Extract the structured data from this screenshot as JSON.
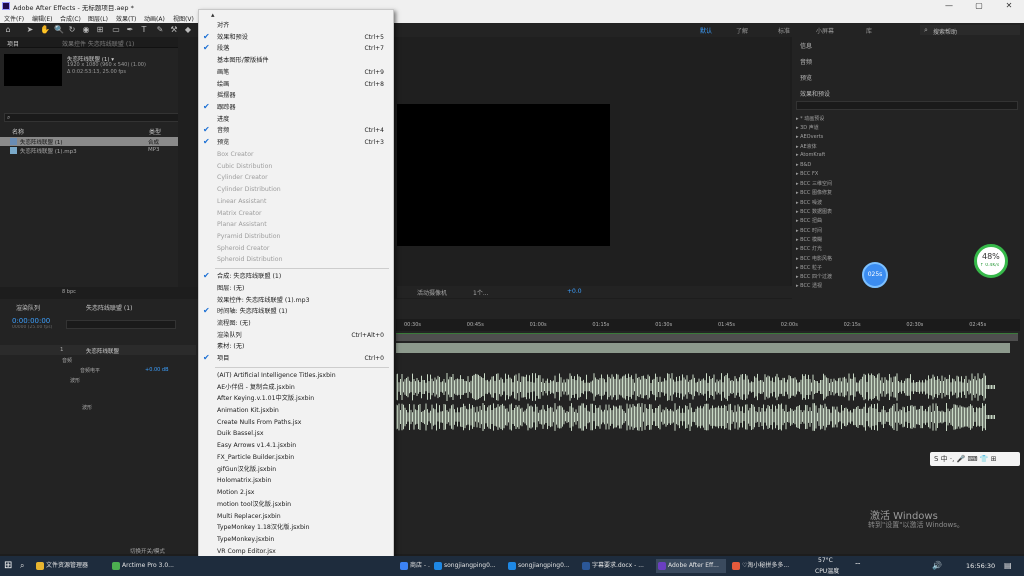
{
  "window": {
    "title": "Adobe After Effects - 无标题项目.aep *",
    "minimize": "—",
    "maximize": "▢",
    "close": "✕"
  },
  "menubar": [
    "文件(F)",
    "编辑(E)",
    "合成(C)",
    "图层(L)",
    "效果(T)",
    "动画(A)",
    "视图(V)"
  ],
  "toolbar": {
    "workspaces": [
      "默认",
      "了解",
      "标准",
      "小屏幕",
      "库"
    ],
    "active_workspace": "默认",
    "search_help": "搜索帮助"
  },
  "project_panel": {
    "tab_project": "项目",
    "tab_effects": "效果控件 失恋阵线联盟 (1)",
    "comp_name": "失恋阵线联盟 (1) ▾",
    "comp_info_1": "1920 x 1080 (960 x 540) (1.00)",
    "comp_info_2": "Δ 0:02:53:13, 25.00 fps",
    "col_name": "名称",
    "col_type": "类型",
    "items": [
      {
        "name": "失恋阵线联盟 (1)",
        "type": "合成"
      },
      {
        "name": "失恋阵线联盟 (1).mp3",
        "type": "MP3"
      }
    ],
    "bpc": "8 bpc"
  },
  "viewer": {
    "camera": "活动摄像机",
    "views": "1个...",
    "exposure": "+0.0"
  },
  "right_panels": {
    "info": "信息",
    "audio": "音频",
    "preview": "预览",
    "effects_presets": "效果和预设",
    "fx_items": [
      "▸ * 动画预设",
      "▸ 3D 声道",
      "▸ AEOverts",
      "▸ AE液体",
      "▸ AtomKraft",
      "▸ B&D",
      "▸ BCC FX",
      "▸ BCC 三维空间",
      "▸ BCC 图像修复",
      "▸ BCC 噪波",
      "▸ BCC 数据图表",
      "▸ BCC 扭曲",
      "▸ BCC 时间",
      "▸ BCC 模糊",
      "▸ BCC 灯光",
      "▸ BCC 电影风格",
      "▸ BCC 粒子",
      "▸ BCC 四个过渡",
      "▸ BCC 透视"
    ]
  },
  "timeline": {
    "render_queue": "渲染队列",
    "comp_tab": "失恋阵线联盟 (1)",
    "timecode": "0:00:00:00",
    "frame_info": "00000 (25.00 fps)",
    "layer_name": "失恋阵线联盟",
    "layer_num": "1",
    "prop_audio": "音频",
    "prop_level": "音频电平",
    "prop_level_val": "+0.00 dB",
    "prop_waveform": "波形",
    "prop_waveform2": "波形",
    "ruler": [
      "00:30s",
      "00:45s",
      "01:00s",
      "01:15s",
      "01:30s",
      "01:45s",
      "02:00s",
      "02:15s",
      "02:30s",
      "02:45s"
    ],
    "switch_mode": "切换开关/模式"
  },
  "window_menu": {
    "items": [
      {
        "label": "对齐",
        "checked": false,
        "shortcut": "",
        "disabled": false
      },
      {
        "label": "效果和预设",
        "checked": true,
        "shortcut": "Ctrl+5",
        "disabled": false
      },
      {
        "label": "段落",
        "checked": true,
        "shortcut": "Ctrl+7",
        "disabled": false
      },
      {
        "label": "基本图形/蒙版插件",
        "checked": false,
        "shortcut": "",
        "disabled": false
      },
      {
        "label": "画笔",
        "checked": false,
        "shortcut": "Ctrl+9",
        "disabled": false
      },
      {
        "label": "绘画",
        "checked": false,
        "shortcut": "Ctrl+8",
        "disabled": false
      },
      {
        "label": "摇摆器",
        "checked": false,
        "shortcut": "",
        "disabled": false
      },
      {
        "label": "跟踪器",
        "checked": true,
        "shortcut": "",
        "disabled": false
      },
      {
        "label": "进度",
        "checked": false,
        "shortcut": "",
        "disabled": false
      },
      {
        "label": "音频",
        "checked": true,
        "shortcut": "Ctrl+4",
        "disabled": false
      },
      {
        "label": "预览",
        "checked": true,
        "shortcut": "Ctrl+3",
        "disabled": false
      },
      {
        "label": "Box Creator",
        "checked": false,
        "shortcut": "",
        "disabled": true
      },
      {
        "label": "Cubic Distribution",
        "checked": false,
        "shortcut": "",
        "disabled": true
      },
      {
        "label": "Cylinder Creator",
        "checked": false,
        "shortcut": "",
        "disabled": true
      },
      {
        "label": "Cylinder Distribution",
        "checked": false,
        "shortcut": "",
        "disabled": true
      },
      {
        "label": "Linear Assistant",
        "checked": false,
        "shortcut": "",
        "disabled": true
      },
      {
        "label": "Matrix Creator",
        "checked": false,
        "shortcut": "",
        "disabled": true
      },
      {
        "label": "Planar Assistant",
        "checked": false,
        "shortcut": "",
        "disabled": true
      },
      {
        "label": "Pyramid Distribution",
        "checked": false,
        "shortcut": "",
        "disabled": true
      },
      {
        "label": "Spheroid Creator",
        "checked": false,
        "shortcut": "",
        "disabled": true
      },
      {
        "label": "Spheroid Distribution",
        "checked": false,
        "shortcut": "",
        "disabled": true
      },
      {
        "sep": true
      },
      {
        "label": "合成: 失恋阵线联盟 (1)",
        "checked": true,
        "shortcut": "",
        "disabled": false
      },
      {
        "label": "图层: (无)",
        "checked": false,
        "shortcut": "",
        "disabled": false
      },
      {
        "label": "效果控件: 失恋阵线联盟 (1).mp3",
        "checked": false,
        "shortcut": "",
        "disabled": false
      },
      {
        "label": "时间轴: 失恋阵线联盟 (1)",
        "checked": true,
        "shortcut": "",
        "disabled": false
      },
      {
        "label": "流程图: (无)",
        "checked": false,
        "shortcut": "",
        "disabled": false
      },
      {
        "label": "渲染队列",
        "checked": false,
        "shortcut": "Ctrl+Alt+0",
        "disabled": false
      },
      {
        "label": "素材: (无)",
        "checked": false,
        "shortcut": "",
        "disabled": false
      },
      {
        "label": "项目",
        "checked": true,
        "shortcut": "Ctrl+0",
        "disabled": false
      },
      {
        "sep": true
      },
      {
        "label": "(AIT) Artificial Intelligence Titles.jsxbin",
        "checked": false,
        "shortcut": "",
        "disabled": false
      },
      {
        "label": "AE小伴侣 - 复制合成.jsxbin",
        "checked": false,
        "shortcut": "",
        "disabled": false
      },
      {
        "label": "After Keying.v.1.01中文版.jsxbin",
        "checked": false,
        "shortcut": "",
        "disabled": false
      },
      {
        "label": "Animation Kit.jsxbin",
        "checked": false,
        "shortcut": "",
        "disabled": false
      },
      {
        "label": "Create Nulls From Paths.jsx",
        "checked": false,
        "shortcut": "",
        "disabled": false
      },
      {
        "label": "Duik Bassel.jsx",
        "checked": false,
        "shortcut": "",
        "disabled": false
      },
      {
        "label": "Easy Arrows v1.4.1.jsxbin",
        "checked": false,
        "shortcut": "",
        "disabled": false
      },
      {
        "label": "FX_Particle Builder.jsxbin",
        "checked": false,
        "shortcut": "",
        "disabled": false
      },
      {
        "label": "gifGun汉化版.jsxbin",
        "checked": false,
        "shortcut": "",
        "disabled": false
      },
      {
        "label": "Holomatrix.jsxbin",
        "checked": false,
        "shortcut": "",
        "disabled": false
      },
      {
        "label": "Motion 2.jsx",
        "checked": false,
        "shortcut": "",
        "disabled": false
      },
      {
        "label": "motion tool汉化版.jsxbin",
        "checked": false,
        "shortcut": "",
        "disabled": false
      },
      {
        "label": "Multi Replacer.jsxbin",
        "checked": false,
        "shortcut": "",
        "disabled": false
      },
      {
        "label": "TypeMonkey 1.18汉化版.jsxbin",
        "checked": false,
        "shortcut": "",
        "disabled": false
      },
      {
        "label": "TypeMonkey.jsxbin",
        "checked": false,
        "shortcut": "",
        "disabled": false
      },
      {
        "label": "VR Comp Editor.jsx",
        "checked": false,
        "shortcut": "",
        "disabled": false
      }
    ]
  },
  "taskbar": {
    "tasks": [
      {
        "label": "文件资源管理器",
        "color": "#e8b530"
      },
      {
        "label": "Arctime Pro 3.0...",
        "color": "#4caf50"
      },
      {
        "label": "商店 - ...",
        "color": "#3b82f6"
      },
      {
        "label": "songjiangping0...",
        "color": "#1e88e5"
      },
      {
        "label": "songjiangping0...",
        "color": "#1e88e5"
      },
      {
        "label": "字幕要求.docx - ...",
        "color": "#2b5797"
      },
      {
        "label": "Adobe After Eff...",
        "color": "#6a3fc1",
        "active": true
      },
      {
        "label": "♡淘小秘拼多多...",
        "color": "#e55a3c"
      }
    ],
    "temperature": "57°C",
    "cpu_label": "CPU温度",
    "time": "16:56:30"
  },
  "overlays": {
    "activate_windows": "激活 Windows",
    "activate_hint": "转到\"设置\"以激活 Windows。",
    "perf_percent": "48%",
    "perf_speed": "↑ 0.4K/s",
    "badge_text": "025s",
    "ime": "S 中 ·, 🎤 ⌨ 👕 ⊞"
  },
  "colors": {
    "accent": "#3da0ff",
    "menu_check": "#1a6fd4",
    "track": "#8d9a8d",
    "waveform": "#c9d9c6"
  }
}
